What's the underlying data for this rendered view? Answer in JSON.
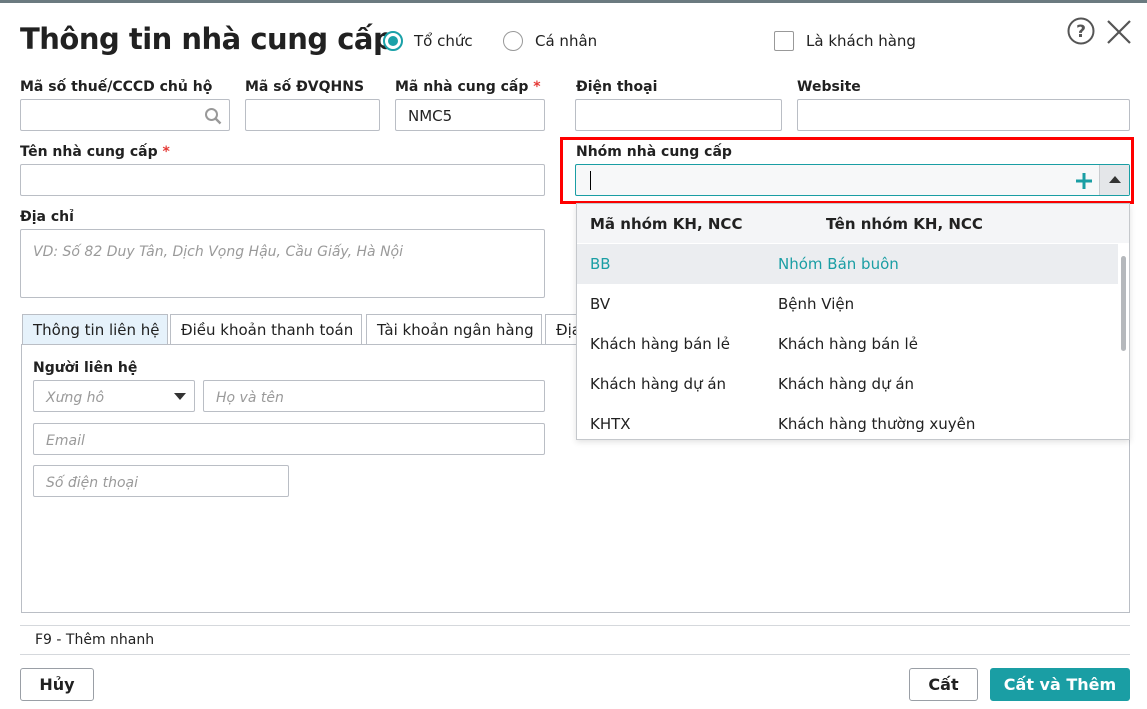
{
  "dialog": {
    "title": "Thông tin nhà cung cấp",
    "type_options": [
      {
        "label": "Tổ chức",
        "selected": true
      },
      {
        "label": "Cá nhân",
        "selected": false
      }
    ],
    "is_customer_label": "Là khách hàng",
    "is_customer": false
  },
  "fields": {
    "tax_label": "Mã số thuế/CCCD chủ hộ",
    "tax_value": "",
    "budget_label": "Mã số ĐVQHNS",
    "budget_value": "",
    "code_label": "Mã nhà cung cấp",
    "code_value": "NMC5",
    "required_mark": "*",
    "phone_label": "Điện thoại",
    "website_label": "Website",
    "name_label": "Tên nhà cung cấp",
    "group_label": "Nhóm nhà cung cấp",
    "group_value": "",
    "address_label": "Địa chỉ",
    "address_placeholder": "VD: Số 82 Duy Tân, Dịch Vọng Hậu, Cầu Giấy, Hà Nội"
  },
  "tabs": [
    "Thông tin liên hệ",
    "Điều khoản thanh toán",
    "Tài khoản ngân hàng",
    "Địa"
  ],
  "contact": {
    "title": "Người liên hệ",
    "salutation_placeholder": "Xưng hô",
    "fullname_placeholder": "Họ và tên",
    "email_placeholder": "Email",
    "phone_placeholder": "Số điện thoại"
  },
  "dropdown": {
    "headers": [
      "Mã nhóm KH, NCC",
      "Tên nhóm KH, NCC"
    ],
    "rows": [
      {
        "code": "BB",
        "name": "Nhóm Bán buôn"
      },
      {
        "code": "BV",
        "name": "Bệnh Viện"
      },
      {
        "code": "Khách hàng bán lẻ",
        "name": "Khách hàng bán lẻ"
      },
      {
        "code": "Khách hàng dự án",
        "name": "Khách hàng dự án"
      },
      {
        "code": "KHTX",
        "name": "Khách hàng thường xuyên"
      }
    ]
  },
  "footer": {
    "hint": "F9 - Thêm nhanh",
    "cancel": "Hủy",
    "save": "Cất",
    "save_add": "Cất và Thêm"
  },
  "colors": {
    "accent": "#1a9ea4",
    "highlight": "#ff0000"
  }
}
